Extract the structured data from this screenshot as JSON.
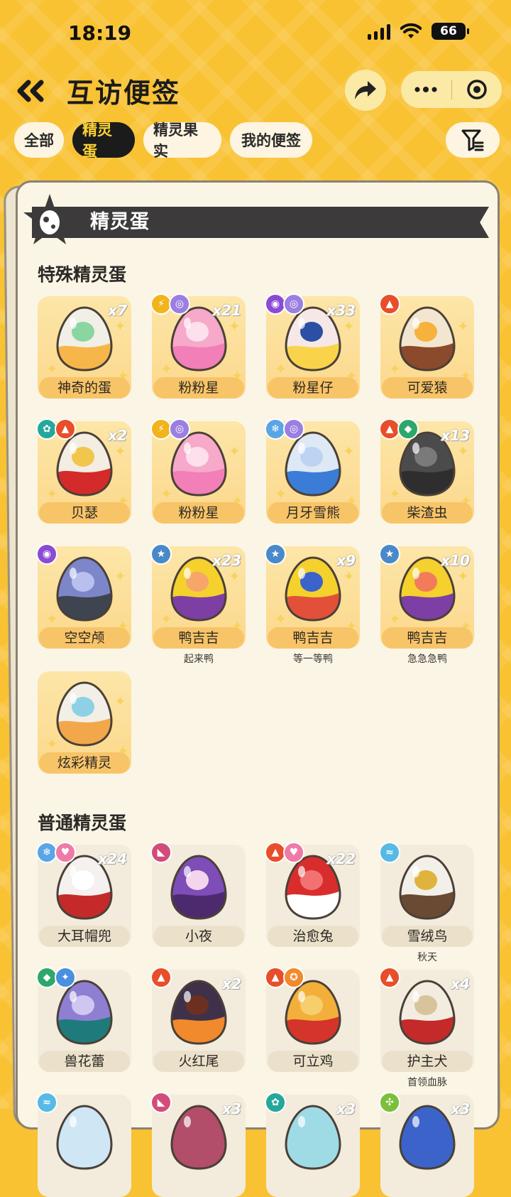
{
  "status": {
    "time": "18:19",
    "battery": "66"
  },
  "header": {
    "title": "互访便签"
  },
  "tabs": [
    {
      "label": "全部",
      "active": false
    },
    {
      "label": "精灵蛋",
      "active": true
    },
    {
      "label": "精灵果实",
      "active": false
    },
    {
      "label": "我的便签",
      "active": false
    }
  ],
  "card": {
    "banner_title": "精灵蛋"
  },
  "sections": {
    "special": {
      "title": "特殊精灵蛋",
      "items": [
        {
          "label": "神奇的蛋",
          "count": "x7",
          "badges": [],
          "egg": [
            "#f2efe6",
            "#f7b64a",
            "#8ad6a0"
          ]
        },
        {
          "label": "粉粉星",
          "count": "x21",
          "badges": [
            "electric",
            "psychic"
          ],
          "egg": [
            "#f6a9c9",
            "#f27fb7",
            "#fde0ec"
          ]
        },
        {
          "label": "粉星仔",
          "count": "x33",
          "badges": [
            "ghost",
            "psychic"
          ],
          "egg": [
            "#f5e8e6",
            "#f9d44a",
            "#2a4fa5"
          ]
        },
        {
          "label": "可爱猿",
          "count": "",
          "badges": [
            "fire"
          ],
          "egg": [
            "#f3e6d1",
            "#8b4a2b",
            "#f6b23c"
          ]
        },
        {
          "label": "贝瑟",
          "count": "x2",
          "badges": [
            "grass2",
            "fire"
          ],
          "egg": [
            "#f4ede2",
            "#d52a2a",
            "#f0c64c"
          ]
        },
        {
          "label": "粉粉星",
          "count": "",
          "badges": [
            "electric",
            "psychic"
          ],
          "egg": [
            "#f6a9c9",
            "#f27fb7",
            "#fde0ec"
          ]
        },
        {
          "label": "月牙雪熊",
          "count": "",
          "badges": [
            "ice",
            "psychic"
          ],
          "egg": [
            "#dfe8f5",
            "#3b7dd6",
            "#bcd4f2"
          ]
        },
        {
          "label": "柴渣虫",
          "count": "x13",
          "badges": [
            "fire",
            "grass"
          ],
          "egg": [
            "#4b4b4b",
            "#2e2e2e",
            "#7a7a7a"
          ]
        },
        {
          "label": "空空颅",
          "count": "",
          "badges": [
            "ghost"
          ],
          "egg": [
            "#7d86c9",
            "#3e4450",
            "#b9c0ee"
          ]
        },
        {
          "label": "鸭吉吉",
          "count": "x23",
          "badges": [
            "normal"
          ],
          "egg": [
            "#f4d12d",
            "#7d3fa3",
            "#f6a66a"
          ],
          "sub": "起来鸭"
        },
        {
          "label": "鸭吉吉",
          "count": "x9",
          "badges": [
            "normal"
          ],
          "egg": [
            "#f4d12d",
            "#e3503a",
            "#3b63c9"
          ],
          "sub": "等一等鸭"
        },
        {
          "label": "鸭吉吉",
          "count": "x10",
          "badges": [
            "normal"
          ],
          "egg": [
            "#f4d12d",
            "#7d3fa3",
            "#f27c5a"
          ],
          "sub": "急急急鸭"
        },
        {
          "label": "炫彩精灵",
          "count": "",
          "badges": [],
          "egg": [
            "#f2efe6",
            "#f2a84a",
            "#8ed0e6"
          ]
        }
      ]
    },
    "normal": {
      "title": "普通精灵蛋",
      "items": [
        {
          "label": "大耳帽兜",
          "count": "x24",
          "badges": [
            "ice",
            "fairy"
          ],
          "egg": [
            "#f4f1ee",
            "#c42a2a",
            "#ffffff"
          ]
        },
        {
          "label": "小夜",
          "count": "",
          "badges": [
            "dark"
          ],
          "egg": [
            "#7e4db8",
            "#4d2a6e",
            "#f3d6ee"
          ]
        },
        {
          "label": "治愈兔",
          "count": "x22",
          "badges": [
            "fire",
            "fairy"
          ],
          "egg": [
            "#d92d2d",
            "#ffffff",
            "#f27272"
          ]
        },
        {
          "label": "雪绒鸟",
          "count": "",
          "badges": [
            "wing"
          ],
          "egg": [
            "#f3f0ea",
            "#6a4a32",
            "#e0b43c"
          ],
          "sub": "秋天"
        },
        {
          "label": "兽花蕾",
          "count": "",
          "badges": [
            "grass",
            "light"
          ],
          "egg": [
            "#8f7fd3",
            "#1f7b7b",
            "#cfc7f2"
          ]
        },
        {
          "label": "火红尾",
          "count": "x2",
          "badges": [
            "fire"
          ],
          "egg": [
            "#40314a",
            "#f08a2c",
            "#6b3020"
          ]
        },
        {
          "label": "可立鸡",
          "count": "",
          "badges": [
            "fire",
            "warrior"
          ],
          "egg": [
            "#f2b03a",
            "#d4342a",
            "#f6cf6c"
          ]
        },
        {
          "label": "护主犬",
          "count": "x4",
          "badges": [
            "fire"
          ],
          "egg": [
            "#f3ece1",
            "#c42a2a",
            "#d7c49a"
          ],
          "sub": "首领血脉"
        },
        {
          "label": "",
          "count": "",
          "badges": [
            "wing"
          ],
          "egg": [
            "#cfe6f5",
            "#cfe6f5",
            "#cfe6f5"
          ]
        },
        {
          "label": "",
          "count": "x3",
          "badges": [
            "dark"
          ],
          "egg": [
            "#b24d6a",
            "#b24d6a",
            "#b24d6a"
          ]
        },
        {
          "label": "",
          "count": "x3",
          "badges": [
            "grass2"
          ],
          "egg": [
            "#9fdbe5",
            "#9fdbe5",
            "#9fdbe5"
          ]
        },
        {
          "label": "",
          "count": "x3",
          "badges": [
            "bug"
          ],
          "egg": [
            "#3b63c9",
            "#3b63c9",
            "#3b63c9"
          ]
        }
      ]
    }
  },
  "badge_colors": {
    "electric": "#f2b41b",
    "psychic": "#9b7fe0",
    "ghost": "#8a4bd3",
    "fire": "#e84e2a",
    "grass": "#2ea86a",
    "grass2": "#25a89a",
    "ice": "#5aa5e6",
    "normal": "#4a89c9",
    "fairy": "#f07aa6",
    "dark": "#d24c7a",
    "wing": "#57b9e6",
    "light": "#4a8fe0",
    "warrior": "#f08a2c",
    "bug": "#7bbf3a"
  },
  "badge_glyphs": {
    "electric": "⚡",
    "psychic": "◎",
    "ghost": "◉",
    "fire": "▲",
    "grass": "◆",
    "grass2": "✿",
    "ice": "❄",
    "normal": "★",
    "fairy": "♥",
    "dark": "◣",
    "wing": "≈",
    "light": "✦",
    "warrior": "✪",
    "bug": "✣"
  }
}
